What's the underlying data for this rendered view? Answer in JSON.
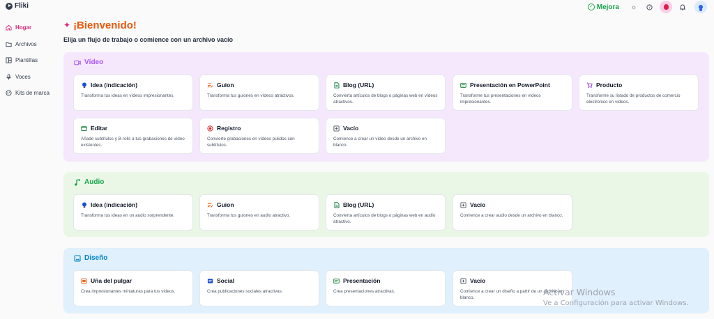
{
  "app": {
    "name": "Fliki"
  },
  "topbar": {
    "upgrade_label": "Mejora"
  },
  "sidebar": {
    "items": [
      {
        "label": "Hogar",
        "icon": "home-icon",
        "active": true
      },
      {
        "label": "Archivos",
        "icon": "folder-icon",
        "active": false
      },
      {
        "label": "Plantillas",
        "icon": "template-icon",
        "active": false
      },
      {
        "label": "Voces",
        "icon": "microphone-icon",
        "active": false
      },
      {
        "label": "Kits de marca",
        "icon": "palette-icon",
        "active": false
      }
    ]
  },
  "header": {
    "title": "¡Bienvenido!",
    "subtitle": "Elija un flujo de trabajo o comience con un archivo vacío"
  },
  "sections": [
    {
      "title": "Vídeo",
      "icon": "video-camera-icon",
      "color": "#a855f7",
      "background": "#f5e8fd",
      "cards": [
        {
          "title": "Idea (indicación)",
          "desc": "Transforma tus ideas en vídeos impresionantes.",
          "icon": "bulb-icon"
        },
        {
          "title": "Guion",
          "desc": "Transforma tus guiones en vídeos atractivos.",
          "icon": "script-icon"
        },
        {
          "title": "Blog (URL)",
          "desc": "Convierta artículos de blogs o páginas web en vídeos atractivos.",
          "icon": "document-icon"
        },
        {
          "title": "Presentación en PowerPoint",
          "desc": "Transforme tus presentaciones en vídeos impresionantes.",
          "icon": "presentation-icon"
        },
        {
          "title": "Producto",
          "desc": "Transforme su listado de productos de comercio electrónico en vídeos.",
          "icon": "cart-icon"
        },
        {
          "title": "Editar",
          "desc": "Añade subtítulos y B-rolls a tus grabaciones de vídeo existentes.",
          "icon": "edit-icon"
        },
        {
          "title": "Registro",
          "desc": "Convierte grabaciones en vídeos pulidos con subtítulos.",
          "icon": "record-icon"
        },
        {
          "title": "Vacío",
          "desc": "Comience a crear un vídeo desde un archivo en blanco.",
          "icon": "plus-square-icon"
        }
      ]
    },
    {
      "title": "Audio",
      "icon": "music-note-icon",
      "color": "#16a34a",
      "background": "#eaf6e6",
      "cards": [
        {
          "title": "Idea (indicación)",
          "desc": "Transforma tus ideas en un audio sorprendente.",
          "icon": "bulb-icon"
        },
        {
          "title": "Guion",
          "desc": "Transforma tus guiones en audio atractivo.",
          "icon": "script-icon"
        },
        {
          "title": "Blog (URL)",
          "desc": "Convierta artículos de blogs o páginas web en audio atractivo.",
          "icon": "document-icon"
        },
        {
          "title": "Vacío",
          "desc": "Comience a crear audio desde un archivo en blanco.",
          "icon": "plus-square-icon"
        }
      ]
    },
    {
      "title": "Diseño",
      "icon": "image-icon",
      "color": "#0284c7",
      "background": "#e0f0fc",
      "cards": [
        {
          "title": "Uña del pulgar",
          "desc": "Crea impresionantes miniaturas para tus vídeos.",
          "icon": "thumbnail-icon"
        },
        {
          "title": "Social",
          "desc": "Crea publicaciones sociales atractivas.",
          "icon": "social-icon"
        },
        {
          "title": "Presentación",
          "desc": "Crea presentaciones atractivas.",
          "icon": "presentation-icon"
        },
        {
          "title": "Vacío",
          "desc": "Comience a crear un diseño a partir de un archivo en blanco.",
          "icon": "plus-square-icon"
        }
      ]
    }
  ],
  "watermark": {
    "title": "Activar Windows",
    "subtitle": "Ve a Configuración para activar Windows."
  },
  "colors": {
    "accent_pink": "#db2777",
    "accent_orange": "#ea580c",
    "upgrade_green": "#16a34a"
  }
}
